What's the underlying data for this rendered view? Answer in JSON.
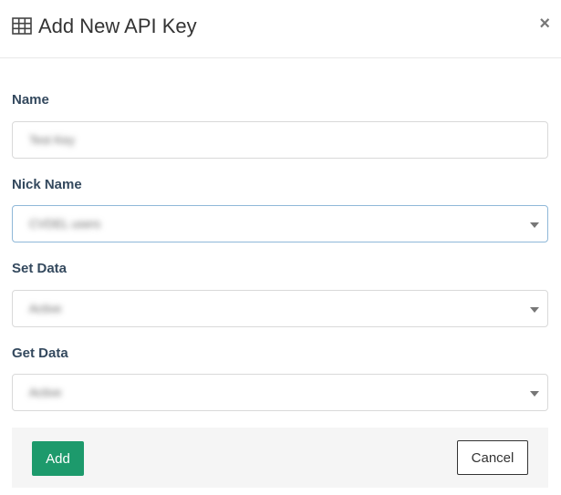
{
  "modal": {
    "title": "Add New API Key",
    "title_icon": "table-grid-icon",
    "close_icon": "close-icon",
    "close_glyph": "×"
  },
  "form": {
    "name": {
      "label": "Name",
      "value": "Test Key"
    },
    "nick_name": {
      "label": "Nick Name",
      "value": "CVDEL users"
    },
    "set_data": {
      "label": "Set Data",
      "value": "Active"
    },
    "get_data": {
      "label": "Get Data",
      "value": "Active"
    }
  },
  "footer": {
    "add_label": "Add",
    "cancel_label": "Cancel"
  },
  "colors": {
    "primary_button": "#1d9a6c",
    "label": "#34495e",
    "focused_border": "#8fb8d8"
  }
}
